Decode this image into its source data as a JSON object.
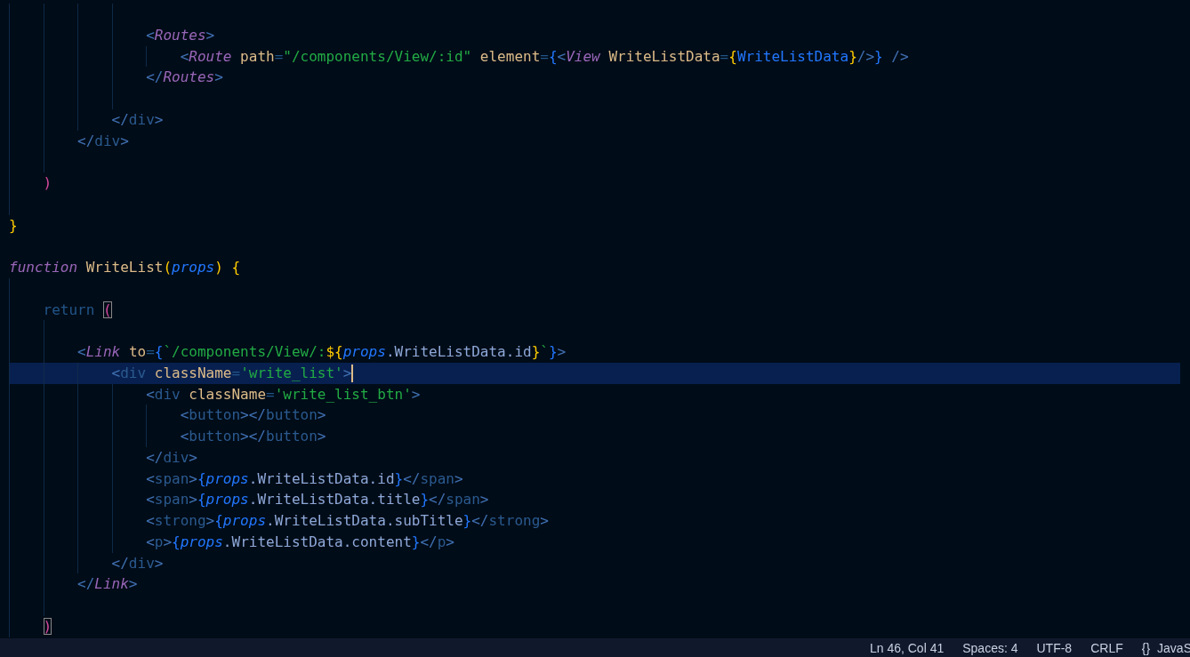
{
  "editor": {
    "lines": [
      {
        "current": false
      },
      {
        "current": false,
        "tokens": [
          {
            "kind": "angle",
            "text": "                <"
          },
          {
            "kind": "component",
            "text": "Routes"
          },
          {
            "kind": "angle",
            "text": ">"
          }
        ]
      },
      {
        "current": false,
        "tokens": [
          {
            "kind": "angle",
            "text": "                    <"
          },
          {
            "kind": "component",
            "text": "Route"
          },
          {
            "kind": "attr",
            "text": " path"
          },
          {
            "kind": "eq",
            "text": "="
          },
          {
            "kind": "string",
            "text": "\"/components/View/:id\""
          },
          {
            "kind": "attr",
            "text": " element"
          },
          {
            "kind": "eq",
            "text": "="
          },
          {
            "kind": "brace-blue",
            "text": "{"
          },
          {
            "kind": "angle",
            "text": "<"
          },
          {
            "kind": "component",
            "text": "View"
          },
          {
            "kind": "attr",
            "text": " WriteListData"
          },
          {
            "kind": "eq",
            "text": "="
          },
          {
            "kind": "brace-yellow",
            "text": "{"
          },
          {
            "kind": "variable",
            "text": "WriteListData"
          },
          {
            "kind": "brace-yellow",
            "text": "}"
          },
          {
            "kind": "angle",
            "text": "/>"
          },
          {
            "kind": "brace-blue",
            "text": "}"
          },
          {
            "kind": "angle",
            "text": " />"
          }
        ]
      },
      {
        "current": false,
        "tokens": [
          {
            "kind": "angle",
            "text": "                </"
          },
          {
            "kind": "component",
            "text": "Routes"
          },
          {
            "kind": "angle",
            "text": ">"
          }
        ]
      },
      {
        "current": false
      },
      {
        "current": false,
        "tokens": [
          {
            "kind": "angle",
            "text": "            </"
          },
          {
            "kind": "tag",
            "text": "div"
          },
          {
            "kind": "angle",
            "text": ">"
          }
        ]
      },
      {
        "current": false,
        "tokens": [
          {
            "kind": "angle",
            "text": "        </"
          },
          {
            "kind": "tag",
            "text": "div"
          },
          {
            "kind": "angle",
            "text": ">"
          }
        ]
      },
      {
        "current": false
      },
      {
        "current": false,
        "tokens": [
          {
            "kind": "paren",
            "text": "    )"
          }
        ]
      },
      {
        "current": false
      },
      {
        "current": false,
        "tokens": [
          {
            "kind": "brace-yellow",
            "text": "}"
          }
        ]
      },
      {
        "current": false
      },
      {
        "current": false,
        "tokens": [
          {
            "kind": "storage",
            "text": "function"
          },
          {
            "kind": "function",
            "text": " WriteList"
          },
          {
            "kind": "brace-yellow",
            "text": "("
          },
          {
            "kind": "param",
            "text": "props"
          },
          {
            "kind": "brace-yellow",
            "text": ")"
          },
          {
            "kind": "brace-yellow",
            "text": " {"
          }
        ]
      },
      {
        "current": false
      },
      {
        "current": false,
        "tokens": [
          {
            "kind": "keyword",
            "text": "    return "
          },
          {
            "kind": "paren-match",
            "text": "("
          }
        ]
      },
      {
        "current": false
      },
      {
        "current": false,
        "tokens": [
          {
            "kind": "angle",
            "text": "        <"
          },
          {
            "kind": "component",
            "text": "Link"
          },
          {
            "kind": "attr",
            "text": " to"
          },
          {
            "kind": "eq",
            "text": "="
          },
          {
            "kind": "brace-blue",
            "text": "{"
          },
          {
            "kind": "string",
            "text": "`/components/View/:"
          },
          {
            "kind": "brace-yellow",
            "text": "${"
          },
          {
            "kind": "param",
            "text": "props"
          },
          {
            "kind": "member",
            "text": ".WriteListData.id"
          },
          {
            "kind": "brace-yellow",
            "text": "}"
          },
          {
            "kind": "string",
            "text": "`"
          },
          {
            "kind": "brace-blue",
            "text": "}"
          },
          {
            "kind": "angle",
            "text": ">"
          }
        ]
      },
      {
        "current": true,
        "tokens": [
          {
            "kind": "angle",
            "text": "            <"
          },
          {
            "kind": "tag",
            "text": "div"
          },
          {
            "kind": "attr",
            "text": " className"
          },
          {
            "kind": "eq",
            "text": "="
          },
          {
            "kind": "string",
            "text": "'write_list'"
          },
          {
            "kind": "angle",
            "text": ">"
          }
        ]
      },
      {
        "current": false,
        "tokens": [
          {
            "kind": "angle",
            "text": "                <"
          },
          {
            "kind": "tag",
            "text": "div"
          },
          {
            "kind": "attr",
            "text": " className"
          },
          {
            "kind": "eq",
            "text": "="
          },
          {
            "kind": "string",
            "text": "'write_list_btn'"
          },
          {
            "kind": "angle",
            "text": ">"
          }
        ]
      },
      {
        "current": false,
        "tokens": [
          {
            "kind": "angle",
            "text": "                    <"
          },
          {
            "kind": "tag",
            "text": "button"
          },
          {
            "kind": "angle",
            "text": "></"
          },
          {
            "kind": "tag",
            "text": "button"
          },
          {
            "kind": "angle",
            "text": ">"
          }
        ]
      },
      {
        "current": false,
        "tokens": [
          {
            "kind": "angle",
            "text": "                    <"
          },
          {
            "kind": "tag",
            "text": "button"
          },
          {
            "kind": "angle",
            "text": "></"
          },
          {
            "kind": "tag",
            "text": "button"
          },
          {
            "kind": "angle",
            "text": ">"
          }
        ]
      },
      {
        "current": false,
        "tokens": [
          {
            "kind": "angle",
            "text": "                </"
          },
          {
            "kind": "tag",
            "text": "div"
          },
          {
            "kind": "angle",
            "text": ">"
          }
        ]
      },
      {
        "current": false,
        "tokens": [
          {
            "kind": "angle",
            "text": "                <"
          },
          {
            "kind": "tag",
            "text": "span"
          },
          {
            "kind": "angle",
            "text": ">"
          },
          {
            "kind": "brace-blue",
            "text": "{"
          },
          {
            "kind": "param",
            "text": "props"
          },
          {
            "kind": "member",
            "text": ".WriteListData.id"
          },
          {
            "kind": "brace-blue",
            "text": "}"
          },
          {
            "kind": "angle",
            "text": "</"
          },
          {
            "kind": "tag",
            "text": "span"
          },
          {
            "kind": "angle",
            "text": ">"
          }
        ]
      },
      {
        "current": false,
        "tokens": [
          {
            "kind": "angle",
            "text": "                <"
          },
          {
            "kind": "tag",
            "text": "span"
          },
          {
            "kind": "angle",
            "text": ">"
          },
          {
            "kind": "brace-blue",
            "text": "{"
          },
          {
            "kind": "param",
            "text": "props"
          },
          {
            "kind": "member",
            "text": ".WriteListData.title"
          },
          {
            "kind": "brace-blue",
            "text": "}"
          },
          {
            "kind": "angle",
            "text": "</"
          },
          {
            "kind": "tag",
            "text": "span"
          },
          {
            "kind": "angle",
            "text": ">"
          }
        ]
      },
      {
        "current": false,
        "tokens": [
          {
            "kind": "angle",
            "text": "                <"
          },
          {
            "kind": "tag",
            "text": "strong"
          },
          {
            "kind": "angle",
            "text": ">"
          },
          {
            "kind": "brace-blue",
            "text": "{"
          },
          {
            "kind": "param",
            "text": "props"
          },
          {
            "kind": "member",
            "text": ".WriteListData.subTitle"
          },
          {
            "kind": "brace-blue",
            "text": "}"
          },
          {
            "kind": "angle",
            "text": "</"
          },
          {
            "kind": "tag",
            "text": "strong"
          },
          {
            "kind": "angle",
            "text": ">"
          }
        ]
      },
      {
        "current": false,
        "tokens": [
          {
            "kind": "angle",
            "text": "                <"
          },
          {
            "kind": "tag",
            "text": "p"
          },
          {
            "kind": "angle",
            "text": ">"
          },
          {
            "kind": "brace-blue",
            "text": "{"
          },
          {
            "kind": "param",
            "text": "props"
          },
          {
            "kind": "member",
            "text": ".WriteListData.content"
          },
          {
            "kind": "brace-blue",
            "text": "}"
          },
          {
            "kind": "angle",
            "text": "</"
          },
          {
            "kind": "tag",
            "text": "p"
          },
          {
            "kind": "angle",
            "text": ">"
          }
        ]
      },
      {
        "current": false,
        "tokens": [
          {
            "kind": "angle",
            "text": "            </"
          },
          {
            "kind": "tag",
            "text": "div"
          },
          {
            "kind": "angle",
            "text": ">"
          }
        ]
      },
      {
        "current": false,
        "tokens": [
          {
            "kind": "angle",
            "text": "        </"
          },
          {
            "kind": "component",
            "text": "Link"
          },
          {
            "kind": "angle",
            "text": ">"
          }
        ]
      },
      {
        "current": false
      },
      {
        "current": false,
        "tokens": [
          {
            "kind": "paren-match",
            "text": "    )"
          }
        ]
      }
    ]
  },
  "status_bar": {
    "position": "Ln 46, Col 41",
    "indentation": "Spaces: 4",
    "encoding": "UTF-8",
    "line_ending": "CRLF",
    "language_icon": "{}",
    "language": "JavaS"
  }
}
